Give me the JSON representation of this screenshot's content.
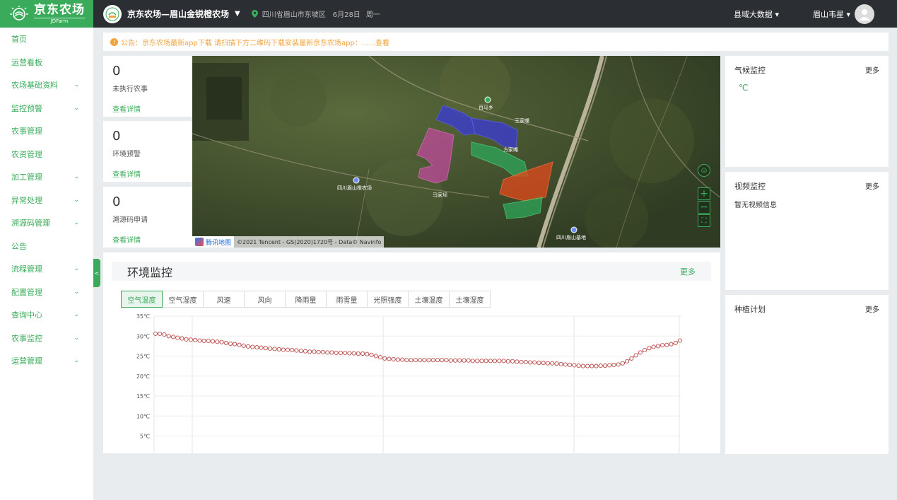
{
  "app": {
    "logo_cn": "京东农场",
    "logo_en": "JDFarm"
  },
  "topbar": {
    "farm_title": "京东农场—眉山金锐橙农场",
    "location": "四川省眉山市东坡区",
    "date": "6月28日",
    "weekday": "周一",
    "county_data": "县域大数据",
    "user_name": "眉山韦星"
  },
  "sidebar": {
    "items": [
      {
        "label": "首页",
        "chevron": ""
      },
      {
        "label": "运营看板",
        "chevron": ""
      },
      {
        "label": "农场基础资料",
        "chevron": "⌄"
      },
      {
        "label": "监控预警",
        "chevron": "⌄"
      },
      {
        "label": "农事管理",
        "chevron": ""
      },
      {
        "label": "农资管理",
        "chevron": ""
      },
      {
        "label": "加工管理",
        "chevron": "⌄"
      },
      {
        "label": "异常处理",
        "chevron": "⌄"
      },
      {
        "label": "溯源码管理",
        "chevron": "⌄"
      },
      {
        "label": "公告",
        "chevron": ""
      },
      {
        "label": "流程管理",
        "chevron": "⌄"
      },
      {
        "label": "配置管理",
        "chevron": "⌄"
      },
      {
        "label": "查询中心",
        "chevron": "⌄"
      },
      {
        "label": "农事监控",
        "chevron": "⌄"
      },
      {
        "label": "运营管理",
        "chevron": "⌄"
      }
    ]
  },
  "notice": {
    "text": "公告：京东农场最新app下载 请扫描下方二维码下载安装最新京东农场app：......查看"
  },
  "stats": [
    {
      "value": "0",
      "label": "未执行农事",
      "link": "查看详情"
    },
    {
      "value": "0",
      "label": "环境预警",
      "link": "查看详情"
    },
    {
      "value": "0",
      "label": "溯源码申请",
      "link": "查看详情"
    }
  ],
  "map": {
    "attribution": "©2021 Tencent - GS(2020)1720号 - Data© Navinfo",
    "provider": "腾讯地图",
    "zoom_in": "+",
    "zoom_out": "−",
    "fullscreen": "⛶",
    "labels": [
      {
        "text": "百马乡"
      },
      {
        "text": "王家嘴"
      },
      {
        "text": "方家嘴"
      },
      {
        "text": "四川眉山橙农场"
      },
      {
        "text": "四川眉山基地"
      },
      {
        "text": "马家坝"
      }
    ]
  },
  "env_monitor": {
    "title": "环境监控",
    "more": "更多",
    "tabs": [
      "空气温度",
      "空气湿度",
      "风速",
      "风向",
      "降雨量",
      "雨雪量",
      "光照强度",
      "土壤温度",
      "土壤湿度"
    ],
    "active_tab": 0
  },
  "chart_data": {
    "type": "line",
    "series": [
      {
        "values": [
          30.6,
          30.6,
          30.4,
          30.0,
          29.8,
          29.6,
          29.4,
          29.2,
          29.1,
          29.0,
          28.9,
          28.8,
          28.8,
          28.7,
          28.6,
          28.5,
          28.3,
          28.1,
          28.0,
          27.8,
          27.6,
          27.4,
          27.3,
          27.2,
          27.1,
          27.0,
          26.9,
          26.8,
          26.7,
          26.6,
          26.6,
          26.5,
          26.4,
          26.3,
          26.2,
          26.1,
          26.1,
          26.0,
          26.0,
          25.9,
          25.9,
          25.8,
          25.8,
          25.8,
          25.7,
          25.7,
          25.6,
          25.6,
          25.5,
          25.3,
          25.0,
          24.7,
          24.4,
          24.3,
          24.2,
          24.1,
          24.1,
          24.0,
          24.0,
          24.0,
          24.0,
          24.0,
          24.0,
          24.0,
          24.0,
          24.0,
          24.0,
          23.9,
          23.9,
          23.9,
          23.9,
          23.9,
          23.8,
          23.8,
          23.8,
          23.8,
          23.8,
          23.8,
          23.8,
          23.8,
          23.7,
          23.7,
          23.6,
          23.5,
          23.5,
          23.4,
          23.4,
          23.3,
          23.3,
          23.2,
          23.2,
          23.1,
          23.0,
          22.9,
          22.8,
          22.7,
          22.6,
          22.5,
          22.5,
          22.5,
          22.5,
          22.6,
          22.6,
          22.7,
          22.8,
          22.9,
          23.2,
          23.7,
          24.4,
          25.2,
          25.9,
          26.5,
          27.0,
          27.3,
          27.5,
          27.7,
          27.8,
          28.0,
          28.3,
          28.9
        ]
      }
    ],
    "y_ticks": [
      "35℃",
      "30℃",
      "25℃",
      "20℃",
      "15℃",
      "10℃",
      "5℃"
    ],
    "ylim": [
      0,
      35
    ],
    "grid": true,
    "line_color": "#b94a48"
  },
  "climate": {
    "title": "气候监控",
    "more": "更多",
    "temp": "℃"
  },
  "video": {
    "title": "视频监控",
    "more": "更多",
    "empty": "暂无视频信息"
  },
  "planting": {
    "title": "种植计划",
    "more": "更多"
  },
  "colors": {
    "brand": "#3aab5a",
    "topbar": "#2b2f33",
    "notice": "#f0a23b"
  }
}
